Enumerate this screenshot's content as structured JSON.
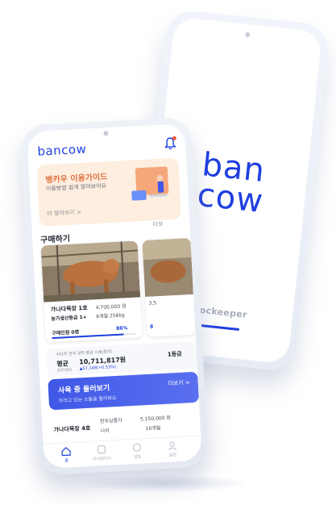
{
  "splash": {
    "logo_line1": "ban",
    "logo_line2": "cow",
    "footer": "stockeeper"
  },
  "app": {
    "logo": "bancow",
    "guide": {
      "title": "뱅카우 이용가이드",
      "subtitle": "이용방법 쉽게 알아보아요",
      "link": "더 알아보기 >"
    },
    "buy_section": {
      "title": "구매하기",
      "more": "더보"
    },
    "cards": [
      {
        "name": "가나다목장 1호",
        "grade": "농가생산등급 1+",
        "price": "4,700,000 원",
        "weight": "6개월 258kg",
        "buyers": "구매인원 0명",
        "progress": "86%",
        "progress_value": 0.86
      },
      {
        "price": "3,5",
        "progress": "8"
      }
    ],
    "stats": {
      "label": "지난주 전국 경락 평균 시세(한우)",
      "avg_label": "평균",
      "sub": "전주대비",
      "value": "10,711,817원",
      "change": "▲57,148(+0.53%)",
      "grade": "1등급"
    },
    "peek": {
      "title": "사육 중 둘러보기",
      "subtitle": "자라고 있는 소들을 둘러봐요",
      "more": "더보기 >"
    },
    "list_item": {
      "name": "가나다목장 4호",
      "category": "한우상품가",
      "age": "나이",
      "price": "5,150,000 원",
      "months": "10개월"
    },
    "tabs": [
      {
        "label": "홈"
      },
      {
        "label": "마이페이지"
      },
      {
        "label": "알림"
      },
      {
        "label": "설정"
      }
    ]
  },
  "colors": {
    "brand_blue": "#1f3fe0",
    "guide_bg": "#fdeedf",
    "guide_title": "#e0703d"
  }
}
